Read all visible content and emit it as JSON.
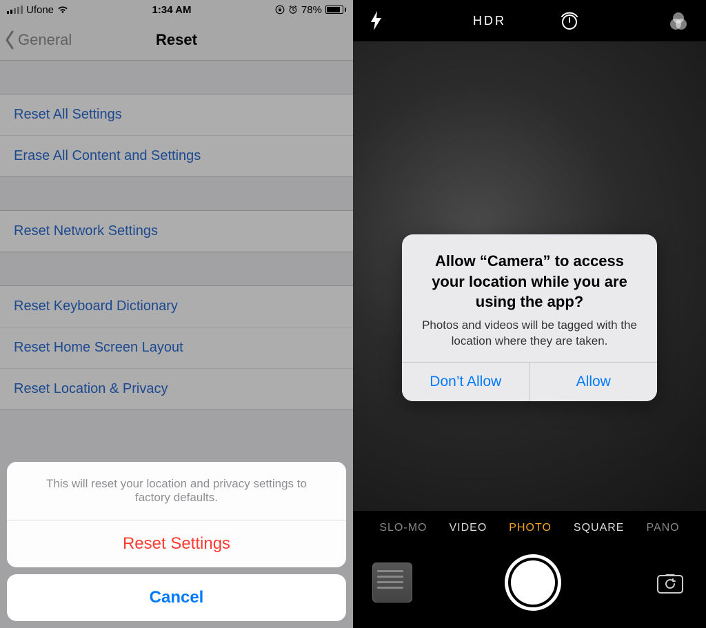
{
  "left": {
    "statusbar": {
      "carrier": "Ufone",
      "time": "1:34 AM",
      "battery_pct": "78%"
    },
    "nav": {
      "back_label": "General",
      "title": "Reset"
    },
    "group1": {
      "reset_all": "Reset All Settings",
      "erase_all": "Erase All Content and Settings"
    },
    "group2": {
      "reset_network": "Reset Network Settings"
    },
    "group3": {
      "reset_keyboard": "Reset Keyboard Dictionary",
      "reset_home": "Reset Home Screen Layout",
      "reset_location": "Reset Location & Privacy"
    },
    "sheet": {
      "message": "This will reset your location and privacy settings to factory defaults.",
      "confirm": "Reset Settings",
      "cancel": "Cancel"
    }
  },
  "right": {
    "top": {
      "hdr": "HDR"
    },
    "modes": {
      "slomo": "SLO-MO",
      "video": "VIDEO",
      "photo": "PHOTO",
      "square": "SQUARE",
      "pano": "PANO"
    },
    "alert": {
      "title": "Allow “Camera” to access your location while you are using the app?",
      "subtitle": "Photos and videos will be tagged with the location where they are taken.",
      "dont_allow": "Don’t Allow",
      "allow": "Allow"
    }
  }
}
